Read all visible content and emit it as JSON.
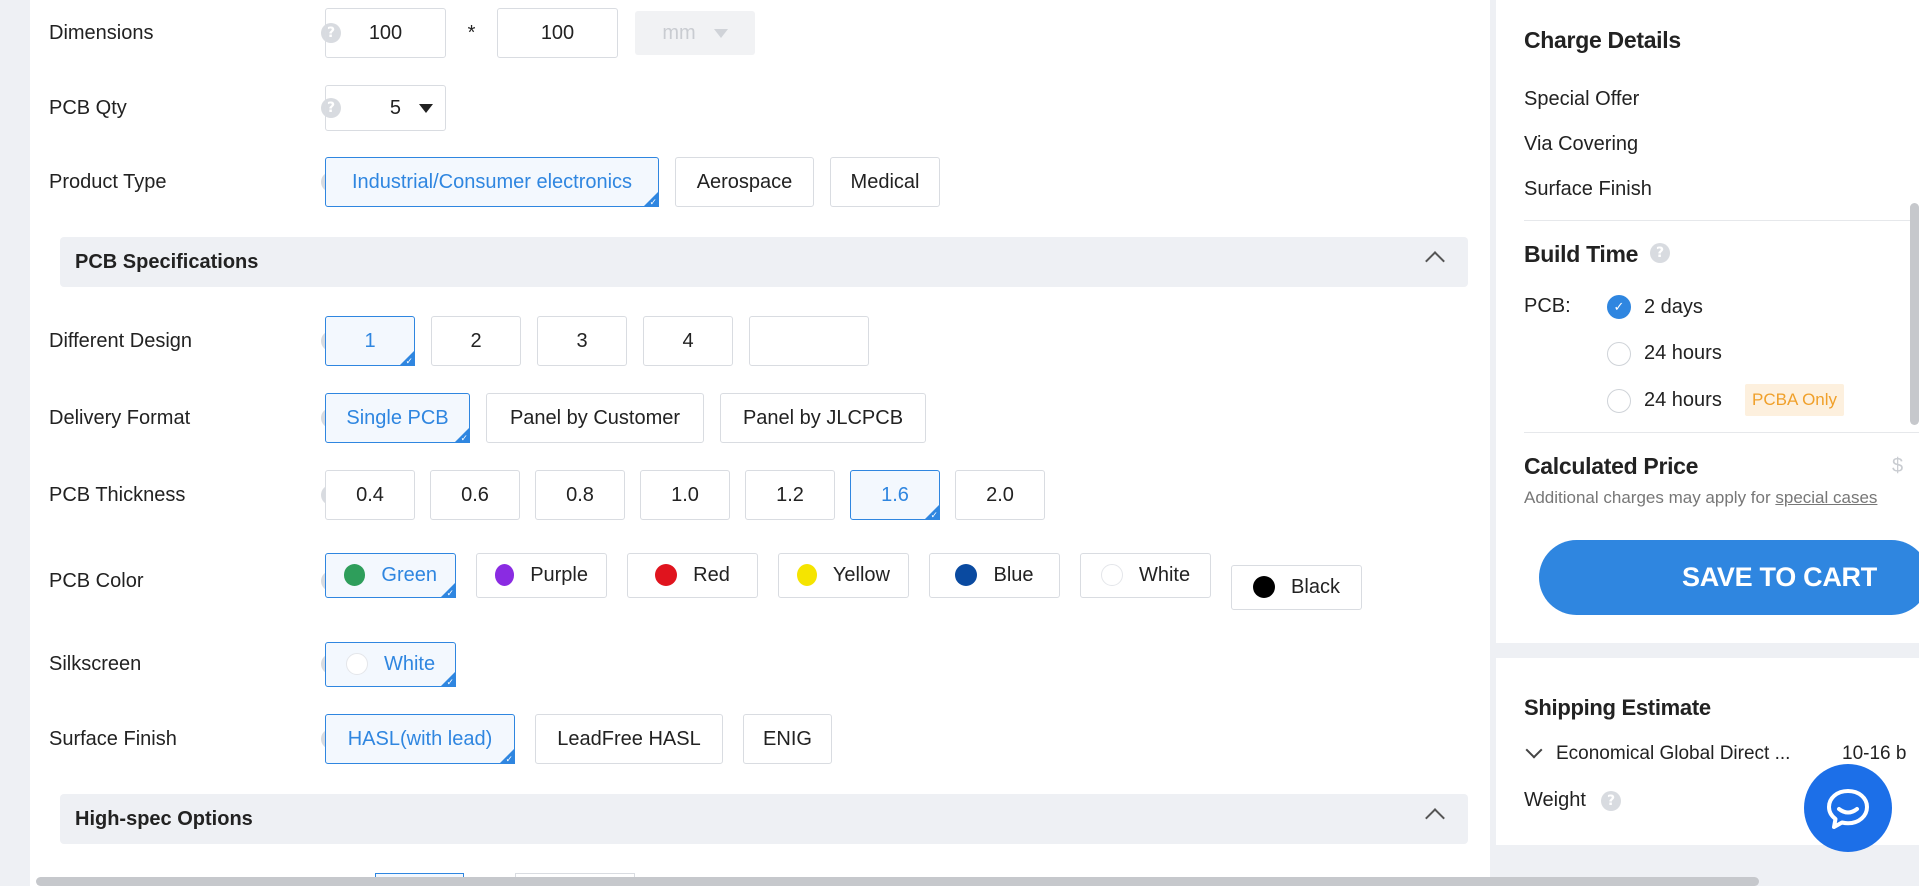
{
  "form": {
    "dimensions": {
      "label": "Dimensions",
      "width": "100",
      "times": "*",
      "height": "100",
      "unit": "mm"
    },
    "pcb_qty": {
      "label": "PCB Qty",
      "value": "5"
    },
    "product_type": {
      "label": "Product Type",
      "options": [
        "Industrial/Consumer electronics",
        "Aerospace",
        "Medical"
      ],
      "selected": "Industrial/Consumer electronics"
    },
    "pcb_spec_section": "PCB Specifications",
    "different_design": {
      "label": "Different Design",
      "options": [
        "1",
        "2",
        "3",
        "4"
      ],
      "selected": "1"
    },
    "delivery_format": {
      "label": "Delivery Format",
      "options": [
        "Single PCB",
        "Panel by Customer",
        "Panel by JLCPCB"
      ],
      "selected": "Single PCB"
    },
    "pcb_thickness": {
      "label": "PCB Thickness",
      "options": [
        "0.4",
        "0.6",
        "0.8",
        "1.0",
        "1.2",
        "1.6",
        "2.0"
      ],
      "selected": "1.6"
    },
    "pcb_color": {
      "label": "PCB Color",
      "options": [
        {
          "name": "Green",
          "color": "#2e9e5b"
        },
        {
          "name": "Purple",
          "color": "#8a2be2"
        },
        {
          "name": "Red",
          "color": "#e0141e"
        },
        {
          "name": "Yellow",
          "color": "#f5e400"
        },
        {
          "name": "Blue",
          "color": "#0a4aa0"
        },
        {
          "name": "White",
          "color": "#ffffff"
        },
        {
          "name": "Black",
          "color": "#000000"
        }
      ],
      "selected": "Green"
    },
    "silkscreen": {
      "label": "Silkscreen",
      "option": "White"
    },
    "surface_finish": {
      "label": "Surface Finish",
      "options": [
        "HASL(with lead)",
        "LeadFree HASL",
        "ENIG"
      ],
      "selected": "HASL(with lead)"
    },
    "high_spec_section": "High-spec Options"
  },
  "charge_details": {
    "title": "Charge Details",
    "items": [
      "Special Offer",
      "Via Covering",
      "Surface Finish"
    ]
  },
  "build_time": {
    "title": "Build Time",
    "pcb_label": "PCB:",
    "options": [
      {
        "label": "2 days",
        "checked": true
      },
      {
        "label": "24 hours",
        "checked": false
      },
      {
        "label": "24 hours",
        "checked": false,
        "badge": "PCBA Only"
      }
    ]
  },
  "price": {
    "title": "Calculated Price",
    "currency": "$",
    "note": "Additional charges may apply for",
    "note_link": "special cases"
  },
  "save_button": "SAVE TO CART",
  "shipping": {
    "title": "Shipping Estimate",
    "method": "Economical Global Direct ...",
    "time": "10-16 b",
    "weight_label": "Weight"
  },
  "colors": {
    "accent": "#2f86e0",
    "badge": "#f0a02a",
    "chat": "#1c6fe8"
  }
}
